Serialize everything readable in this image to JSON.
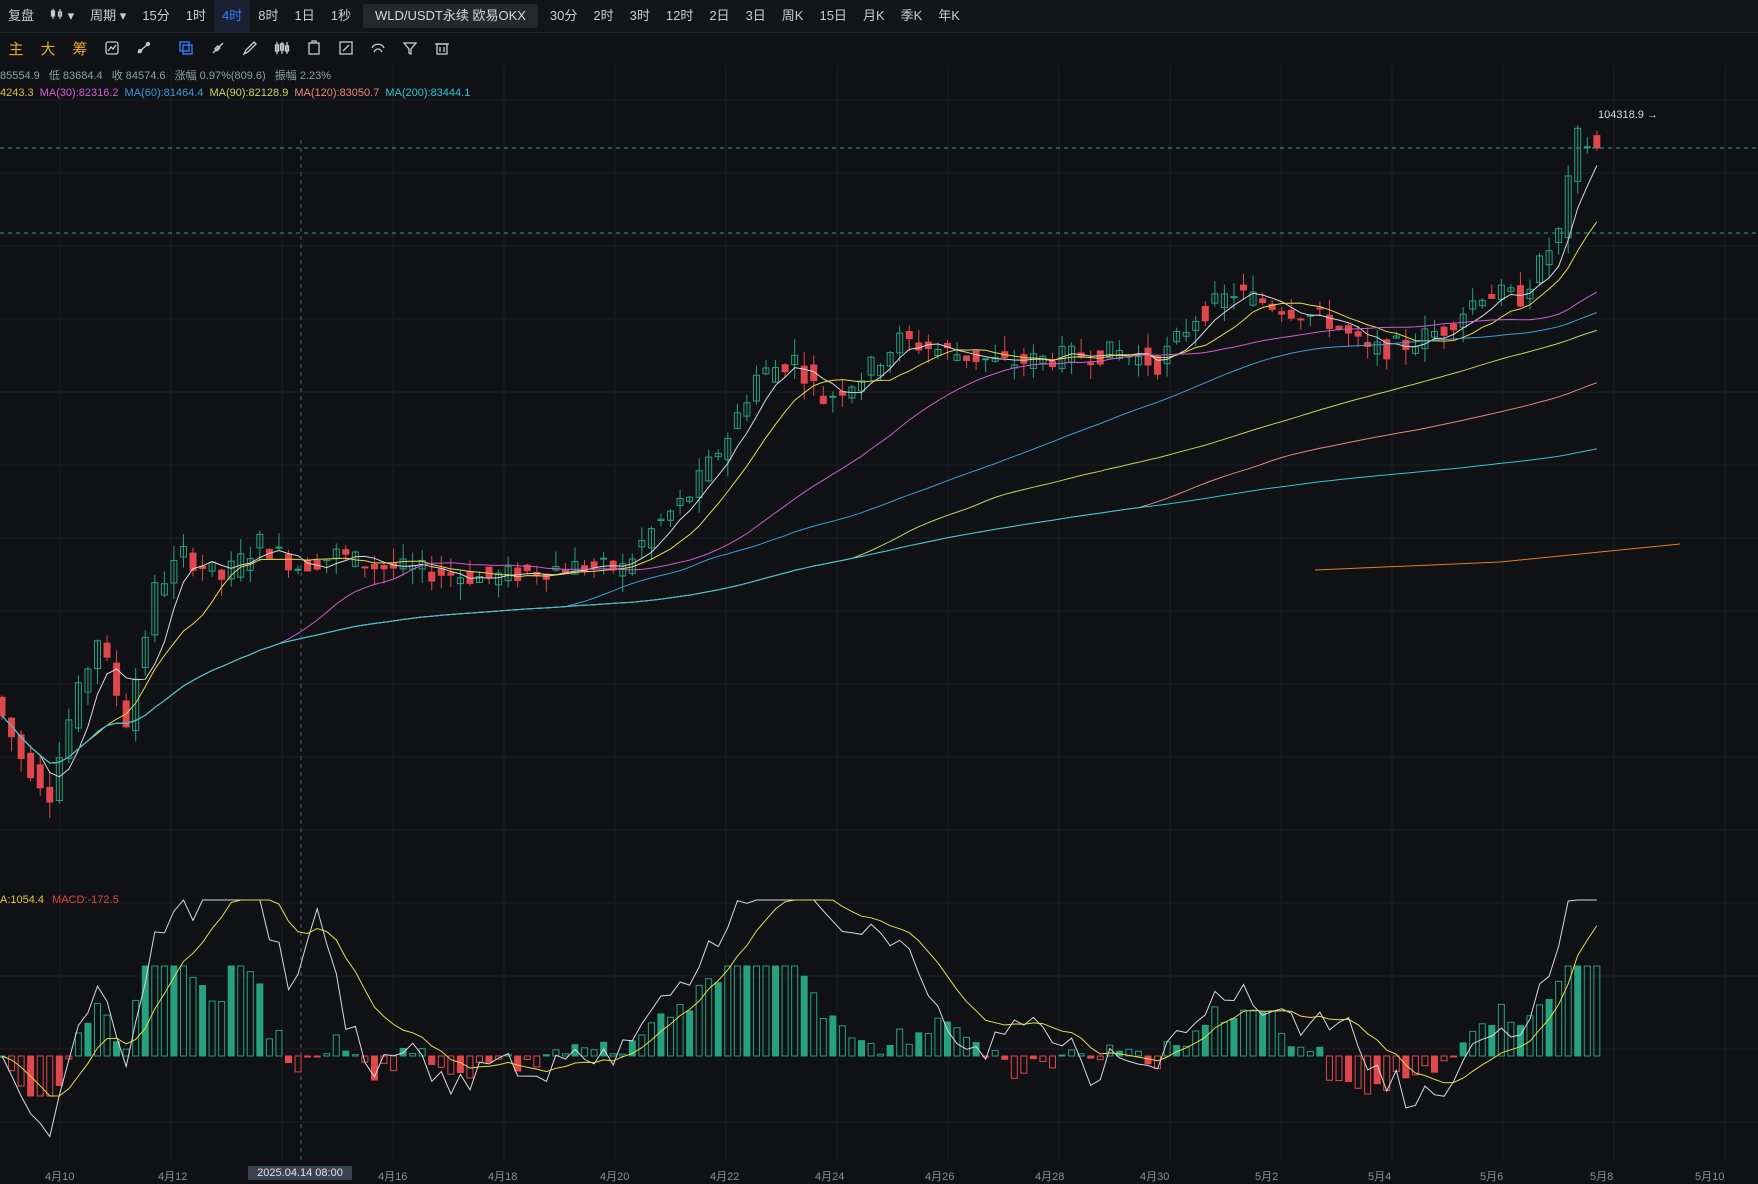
{
  "toolbar": {
    "items": [
      "复盘",
      "",
      "周期",
      "15分",
      "1时",
      "4时",
      "8时",
      "1日",
      "1秒"
    ],
    "active_index": 5,
    "symbol": "WLD/USDT永续 欧易OKX",
    "periods": [
      "30分",
      "2时",
      "3时",
      "12时",
      "2日",
      "3日",
      "周K",
      "15日",
      "月K",
      "季K",
      "年K"
    ]
  },
  "tools": {
    "chinese": [
      "主",
      "大",
      "筹"
    ],
    "icons": [
      "indicator-icon",
      "draw-icon",
      "select-icon",
      "line-icon",
      "pencil-icon",
      "candle-type-icon",
      "copy-icon",
      "edit-icon",
      "eye-icon",
      "filter-icon",
      "trash-icon"
    ]
  },
  "legend": {
    "ohlc": [
      "85554.9",
      "低 83684.4",
      "收 84574.6",
      "涨幅 0.97%(809.6)",
      "振幅 2.23%"
    ],
    "ma": [
      {
        "text": "4243.3",
        "color": "#e9b83f"
      },
      {
        "text": "MA(30):82316.2",
        "color": "#d05bd1"
      },
      {
        "text": "MA(60):81464.4",
        "color": "#3d9bd9"
      },
      {
        "text": "MA(90):82128.9",
        "color": "#c9d25f"
      },
      {
        "text": "MA(120):83050.7",
        "color": "#e58a7a"
      },
      {
        "text": "MA(200):83444.1",
        "color": "#2ec6d3"
      }
    ],
    "macd": [
      {
        "text": "A:1054.4",
        "color": "#e9c23f"
      },
      {
        "text": "MACD:-172.5",
        "color": "#e0473f"
      }
    ]
  },
  "price_marker": "104318.9 →",
  "x_axis": {
    "labels": [
      "4月10",
      "4月12",
      "4月16",
      "4月18",
      "4月20",
      "4月22",
      "4月24",
      "4月26",
      "4月28",
      "4月30",
      "5月2",
      "5月4",
      "5月6",
      "5月8",
      "5月10"
    ],
    "highlight": "2025.04.14 08:00"
  },
  "colors": {
    "up": "#26a07e",
    "down": "#e0474c",
    "bg": "#0f1114"
  },
  "chart_data": {
    "type": "candlestick",
    "title": "WLD/USDT永续 欧易OKX",
    "interval": "4时",
    "last_close": 84574.6,
    "high_marker": 104318.9,
    "ma_values": {
      "MA30": 82316.2,
      "MA60": 81464.4,
      "MA90": 82128.9,
      "MA120": 83050.7,
      "MA200": 83444.1
    },
    "macd_value": -172.5
  }
}
